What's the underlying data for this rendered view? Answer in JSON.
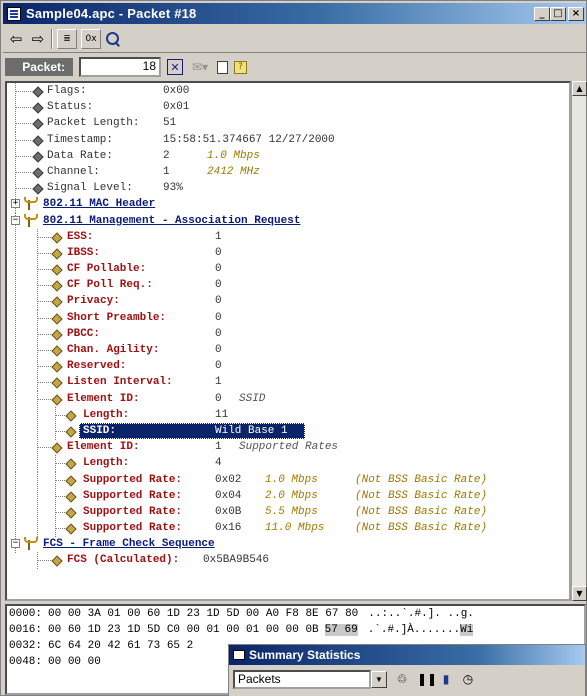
{
  "window": {
    "title": "Sample04.apc - Packet #18",
    "controls": {
      "minimize": "_",
      "restore": "□",
      "close": "×"
    }
  },
  "toolbar": {
    "items": [
      "back-arrow-icon",
      "forward-arrow-icon",
      "decode-view-icon",
      "hex-view-icon",
      "find-icon"
    ],
    "hex_label": "0x"
  },
  "packetbar": {
    "label": "Packet:",
    "number": "18"
  },
  "tree": {
    "general": [
      {
        "label": "Flags:",
        "value": "0x00",
        "extra": ""
      },
      {
        "label": "Status:",
        "value": "0x01",
        "extra": ""
      },
      {
        "label": "Packet Length:",
        "value": "51",
        "extra": ""
      },
      {
        "label": "Timestamp:",
        "value": "15:58:51.374667 12/27/2000",
        "extra": ""
      },
      {
        "label": "Data Rate:",
        "value": "2",
        "extra": "1.0 Mbps"
      },
      {
        "label": "Channel:",
        "value": "1",
        "extra": "2412 MHz"
      },
      {
        "label": "Signal Level:",
        "value": "93%",
        "extra": ""
      }
    ],
    "mac_header": "802.11 MAC Header",
    "management": "802.11 Management - Association Request",
    "mgmt_fields": [
      {
        "label": "ESS:",
        "value": "1",
        "extra": ""
      },
      {
        "label": "IBSS:",
        "value": "0",
        "extra": ""
      },
      {
        "label": "CF Pollable:",
        "value": "0",
        "extra": ""
      },
      {
        "label": "CF Poll Req.:",
        "value": "0",
        "extra": ""
      },
      {
        "label": "Privacy:",
        "value": "0",
        "extra": ""
      },
      {
        "label": "Short Preamble:",
        "value": "0",
        "extra": ""
      },
      {
        "label": "PBCC:",
        "value": "0",
        "extra": ""
      },
      {
        "label": "Chan. Agility:",
        "value": "0",
        "extra": ""
      },
      {
        "label": "Reserved:",
        "value": "0",
        "extra": ""
      },
      {
        "label": "Listen Interval:",
        "value": "1",
        "extra": ""
      },
      {
        "label": "Element ID:",
        "value": "0",
        "extra": "SSID"
      }
    ],
    "ssid_sub": [
      {
        "label": "Length:",
        "value": "11",
        "extra": ""
      },
      {
        "label": "SSID:",
        "value": "Wild Base 1",
        "extra": ""
      }
    ],
    "rates_element": {
      "label": "Element ID:",
      "value": "1",
      "extra": "Supported Rates"
    },
    "rates_sub": [
      {
        "label": "Length:",
        "value": "4",
        "extra": "",
        "note": ""
      },
      {
        "label": "Supported Rate:",
        "value": "0x02",
        "extra": "1.0 Mbps",
        "note": "(Not BSS Basic Rate)"
      },
      {
        "label": "Supported Rate:",
        "value": "0x04",
        "extra": "2.0 Mbps",
        "note": "(Not BSS Basic Rate)"
      },
      {
        "label": "Supported Rate:",
        "value": "0x0B",
        "extra": "5.5 Mbps",
        "note": "(Not BSS Basic Rate)"
      },
      {
        "label": "Supported Rate:",
        "value": "0x16",
        "extra": "11.0 Mbps",
        "note": "(Not BSS Basic Rate)"
      }
    ],
    "fcs": "FCS - Frame Check Sequence",
    "fcs_field": {
      "label": "FCS (Calculated):",
      "value": "0x5BA9B546"
    }
  },
  "hex": [
    {
      "offset": "0000:",
      "bytes": "00 00 3A 01 00 60 1D 23 1D 5D 00 A0 F8 8E 67 80",
      "ascii": "..:..`.#.]. ..g.",
      "hl_bytes": "",
      "hl_ascii": ""
    },
    {
      "offset": "0016:",
      "bytes": "00 60 1D 23 1D 5D C0 00 01 00 01 00 00 0B",
      "ascii": ".`.#.]À.......",
      "hl_bytes": "57 69",
      "hl_ascii": "Wi"
    },
    {
      "offset": "0032:",
      "bytes": "6C 64 20 42 61 73 65 2",
      "ascii": "",
      "hl_bytes": "",
      "hl_ascii": ""
    },
    {
      "offset": "0048:",
      "bytes": "00 00 00",
      "ascii": "",
      "hl_bytes": "",
      "hl_ascii": ""
    }
  ],
  "summary": {
    "title": "Summary Statistics",
    "select_value": "Packets"
  }
}
